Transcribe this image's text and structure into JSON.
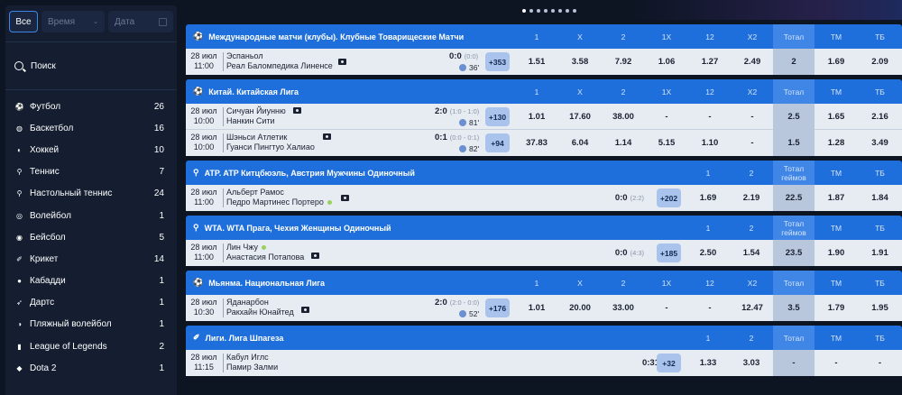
{
  "filters": {
    "all": "Все",
    "time": "Время",
    "date": "Дата"
  },
  "search_label": "Поиск",
  "sports": [
    {
      "name": "Футбол",
      "count": "26",
      "icon": "soccer-icon"
    },
    {
      "name": "Баскетбол",
      "count": "16",
      "icon": "basketball-icon"
    },
    {
      "name": "Хоккей",
      "count": "10",
      "icon": "hockey-icon"
    },
    {
      "name": "Теннис",
      "count": "7",
      "icon": "tennis-icon"
    },
    {
      "name": "Настольный теннис",
      "count": "24",
      "icon": "table-tennis-icon"
    },
    {
      "name": "Волейбол",
      "count": "1",
      "icon": "volleyball-icon"
    },
    {
      "name": "Бейсбол",
      "count": "5",
      "icon": "baseball-icon"
    },
    {
      "name": "Крикет",
      "count": "14",
      "icon": "cricket-icon"
    },
    {
      "name": "Кабадди",
      "count": "1",
      "icon": "kabaddi-icon"
    },
    {
      "name": "Дартс",
      "count": "1",
      "icon": "darts-icon"
    },
    {
      "name": "Пляжный волейбол",
      "count": "1",
      "icon": "beach-volleyball-icon"
    },
    {
      "name": "League of Legends",
      "count": "2",
      "icon": "lol-icon"
    },
    {
      "name": "Dota 2",
      "count": "1",
      "icon": "dota-icon"
    }
  ],
  "leagues": [
    {
      "name": "Международные матчи (клубы).  Клубные Товарищеские Матчи",
      "icon": "soccer-icon",
      "cols": "full",
      "headers": [
        "1",
        "X",
        "2",
        "1X",
        "12",
        "X2",
        "Тотал",
        "ТМ",
        "ТБ"
      ],
      "matches": [
        {
          "date": "28 июл",
          "time": "11:00",
          "team1": "Эспаньол",
          "team2": "Реал Баломпедика Линенсе",
          "score": "0:0",
          "half": "(0:0)",
          "minute": "36'",
          "more": "+353",
          "odds": [
            "1.51",
            "3.58",
            "7.92",
            "1.06",
            "1.27",
            "2.49",
            "2",
            "1.69",
            "2.09"
          ]
        }
      ]
    },
    {
      "name": "Китай.  Китайская Лига",
      "icon": "soccer-icon",
      "cols": "full",
      "headers": [
        "1",
        "X",
        "2",
        "1X",
        "12",
        "X2",
        "Тотал",
        "ТМ",
        "ТБ"
      ],
      "matches": [
        {
          "date": "28 июл",
          "time": "10:00",
          "team1": "Сичуан Йиунню",
          "team2": "Нанкин Сити",
          "score": "2:0",
          "half": "(1:0 - 1:0)",
          "minute": "81'",
          "more": "+130",
          "odds": [
            "1.01",
            "17.60",
            "38.00",
            "-",
            "-",
            "-",
            "2.5",
            "1.65",
            "2.16"
          ]
        },
        {
          "date": "28 июл",
          "time": "10:00",
          "team1": "Шэньси Атлетик",
          "team2": "Гуанси Пингтуо Халиао",
          "score": "0:1",
          "half": "(0:0 - 0:1)",
          "minute": "82'",
          "more": "+94",
          "odds": [
            "37.83",
            "6.04",
            "1.14",
            "5.15",
            "1.10",
            "-",
            "1.5",
            "1.28",
            "3.49"
          ]
        }
      ]
    },
    {
      "name": "ATP.  ATP Китцбюэль, Австрия Мужчины Одиночный",
      "icon": "tennis-icon",
      "cols": "tennis",
      "headers": [
        "1",
        "2",
        "Тотал геймов",
        "ТМ",
        "ТБ"
      ],
      "matches": [
        {
          "date": "28 июл",
          "time": "11:00",
          "team1": "Альберт Рамос",
          "team2": "Педро Мартинес Портеро",
          "serve": "team2",
          "score": "0:0",
          "half": "(2:2)",
          "more": "+202",
          "odds": [
            "1.69",
            "2.19",
            "22.5",
            "1.87",
            "1.84"
          ]
        }
      ]
    },
    {
      "name": "WTA.  WTA Прага, Чехия Женщины Одиночный",
      "icon": "tennis-icon",
      "cols": "tennis",
      "headers": [
        "1",
        "2",
        "Тотал геймов",
        "ТМ",
        "ТБ"
      ],
      "matches": [
        {
          "date": "28 июл",
          "time": "11:00",
          "team1": "Лин Чжу",
          "team2": "Анастасия Потапова",
          "serve": "team1",
          "score": "0:0",
          "half": "(4:3)",
          "more": "+185",
          "odds": [
            "2.50",
            "1.54",
            "23.5",
            "1.90",
            "1.91"
          ]
        }
      ]
    },
    {
      "name": "Мьянма.  Национальная Лига",
      "icon": "soccer-icon",
      "cols": "full",
      "headers": [
        "1",
        "X",
        "2",
        "1X",
        "12",
        "X2",
        "Тотал",
        "ТМ",
        "ТБ"
      ],
      "matches": [
        {
          "date": "28 июл",
          "time": "10:30",
          "team1": "Яданарбон",
          "team2": "Ракхайн Юнайтед",
          "score": "2:0",
          "half": "(2:0 - 0:0)",
          "minute": "52'",
          "more": "+176",
          "odds": [
            "1.01",
            "20.00",
            "33.00",
            "-",
            "-",
            "12.47",
            "3.5",
            "1.79",
            "1.95"
          ]
        }
      ]
    },
    {
      "name": "Лиги.  Лига Шпагеза",
      "icon": "cricket-icon",
      "cols": "tennis",
      "headers": [
        "1",
        "2",
        "Тотал",
        "ТМ",
        "ТБ"
      ],
      "matches": [
        {
          "date": "28 июл",
          "time": "11:15",
          "team1": "Кабул Иглс",
          "team2": "Памир Залми",
          "score": "0:31",
          "half": "",
          "more": "+32",
          "odds": [
            "1.33",
            "3.03",
            "-",
            "-",
            "-"
          ]
        }
      ]
    }
  ]
}
